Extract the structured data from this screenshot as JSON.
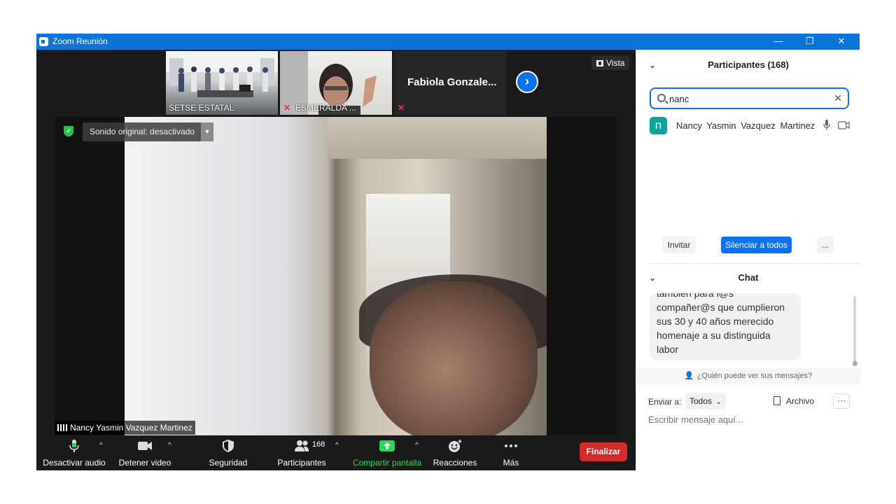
{
  "window": {
    "title": "Zoom Reunión",
    "minimize": "—",
    "restore": "❐",
    "close": "✕"
  },
  "thumbnails": [
    {
      "label": "SETSE ESTATAL",
      "muted": false
    },
    {
      "label": "ESMERALDA ...",
      "muted": true
    },
    {
      "label": "Fabiola  Gonzale...",
      "muted": true
    }
  ],
  "view_button": "Vista",
  "main_video": {
    "audio_notice": "Sonido original: desactivado",
    "speaker_name": "Nancy  Yasmin Vazquez Martinez"
  },
  "toolbar": {
    "mute": "Desactivar audio",
    "video": "Detener video",
    "security": "Seguridad",
    "participants": "Participantes",
    "participants_count": "168",
    "share": "Compartir pantalla",
    "reactions": "Reacciones",
    "more": "Más",
    "end": "Finalizar"
  },
  "participants_panel": {
    "title": "Participantes (168)",
    "search_value": "nanc",
    "results": [
      {
        "initial": "n",
        "name": "Nancy  Yasmin Vazquez Martinez",
        "avatar_color": "#0ea39a"
      }
    ],
    "invite": "Invitar",
    "mute_all": "Silenciar a todos",
    "more": "..."
  },
  "chat_panel": {
    "title": "Chat",
    "message_lines": [
      "también para l@s",
      "compañer@s que cumplieron",
      "sus 30 y 40 años merecido",
      "homenaje a su distinguida",
      "labor"
    ],
    "who_can_see": "¿Quién puede ver sus mensajes?",
    "send_to_label": "Enviar a:",
    "send_to_value": "Todos",
    "file": "Archivo",
    "more": "···",
    "input_placeholder": "Escribir mensaje aquí..."
  },
  "colors": {
    "titlebar": "#0b74d8",
    "accent": "#0e72ed",
    "end_button": "#d22b2b",
    "share_green": "#23d959",
    "muted_red": "#e0383e"
  }
}
